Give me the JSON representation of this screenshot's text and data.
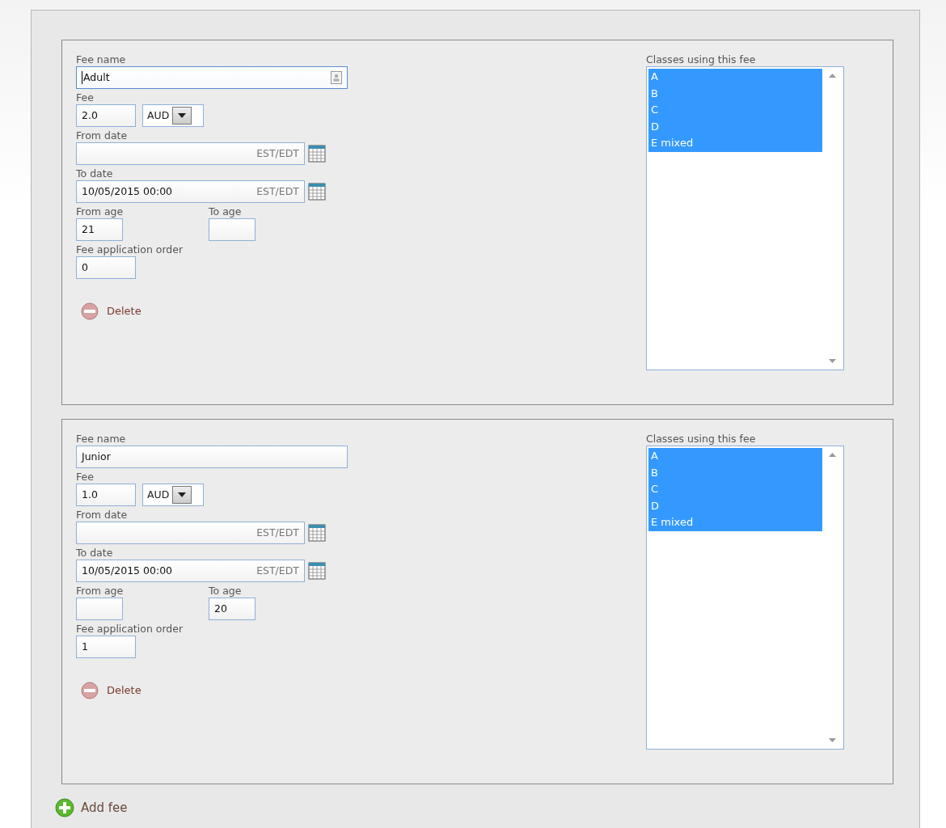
{
  "fees": [
    {
      "name_label": "Fee name",
      "name": "Adult",
      "focused": true,
      "fee_label": "Fee",
      "fee": "2.0",
      "currency": "AUD",
      "from_date_label": "From date",
      "from_date_zone": "EST/EDT",
      "to_date_label": "To date",
      "to_date": "10/05/2015 00:00",
      "to_date_zone": "EST/EDT",
      "from_age_label": "From age",
      "from_age": "21",
      "to_age_label": "To age",
      "order_label": "Fee application order",
      "order": "0",
      "delete": "Delete",
      "classes_label": "Classes using this fee",
      "classes": [
        {
          "label": "A",
          "selected": true
        },
        {
          "label": "B",
          "selected": true
        },
        {
          "label": "C",
          "selected": true
        },
        {
          "label": "D",
          "selected": true
        },
        {
          "label": "E mixed",
          "selected": true
        }
      ]
    },
    {
      "name_label": "Fee name",
      "name": "Junior",
      "focused": false,
      "fee_label": "Fee",
      "fee": "1.0",
      "currency": "AUD",
      "from_date_label": "From date",
      "from_date_zone": "EST/EDT",
      "to_date_label": "To date",
      "to_date": "10/05/2015 00:00",
      "to_date_zone": "EST/EDT",
      "from_age_label": "From age",
      "to_age_label": "To age",
      "to_age": "20",
      "order_label": "Fee application order",
      "order": "1",
      "delete": "Delete",
      "classes_label": "Classes using this fee",
      "classes": [
        {
          "label": "A",
          "selected": true
        },
        {
          "label": "B",
          "selected": true
        },
        {
          "label": "C",
          "selected": true
        },
        {
          "label": "D",
          "selected": true
        },
        {
          "label": "E mixed",
          "selected": true
        }
      ]
    }
  ],
  "add_fee": "Add fee"
}
